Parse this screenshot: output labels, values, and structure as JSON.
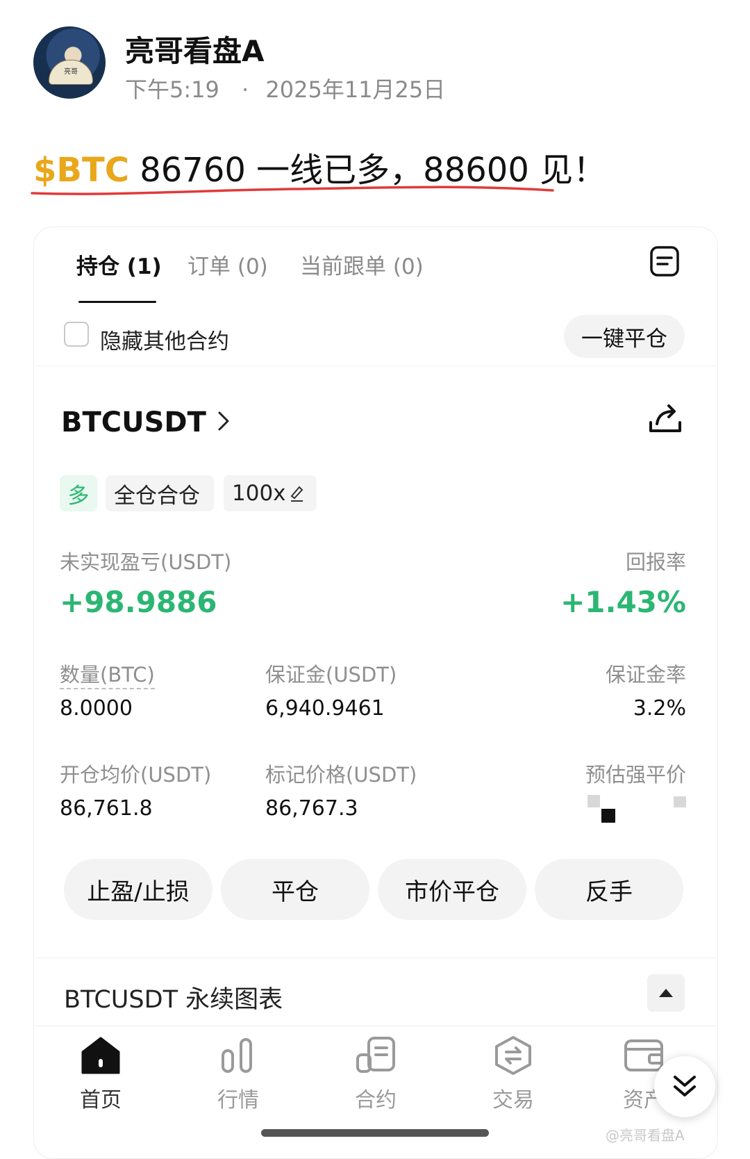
{
  "post": {
    "author": "亮哥看盘A",
    "time": "下午5:19",
    "dot": "·",
    "date": "2025年11月25日",
    "avatar_text": "亮哥",
    "text_ticker": "$BTC",
    "text_body": " 86760 一线已多，88600 见！",
    "accent_color": "#e9a71a",
    "underline_color": "#e03b3b"
  },
  "tabs": [
    {
      "label": "持仓 (1)",
      "active": true
    },
    {
      "label": "订单 (0)",
      "active": false
    },
    {
      "label": "当前跟单 (0)",
      "active": false
    }
  ],
  "filter": {
    "hide_other_label": "隐藏其他合约",
    "close_all_label": "一键平仓"
  },
  "position": {
    "symbol": "BTCUSDT",
    "tags": [
      "多",
      "全仓合仓",
      "100x"
    ],
    "pnl_label": "未实现盈亏(USDT)",
    "pnl_value": "+98.9886",
    "roe_label": "回报率",
    "roe_value": "+1.43%",
    "qty_label": "数量(BTC)",
    "qty_value": "8.0000",
    "margin_label": "保证金(USDT)",
    "margin_value": "6,940.9461",
    "margin_ratio_label": "保证金率",
    "margin_ratio_value": "3.2%",
    "entry_label": "开仓均价(USDT)",
    "entry_value": "86,761.8",
    "mark_label": "标记价格(USDT)",
    "mark_value": "86,767.3",
    "liq_label": "预估强平价",
    "green_color": "#2bb673"
  },
  "actions": [
    "止盈/止损",
    "平仓",
    "市价平仓",
    "反手"
  ],
  "chart_section": {
    "title": "BTCUSDT 永续图表"
  },
  "bottom_nav": [
    {
      "label": "首页",
      "icon": "home-icon",
      "active": true
    },
    {
      "label": "行情",
      "icon": "market-icon",
      "active": false
    },
    {
      "label": "合约",
      "icon": "contract-icon",
      "active": false
    },
    {
      "label": "交易",
      "icon": "trade-icon",
      "active": false
    },
    {
      "label": "资产",
      "icon": "wallet-icon",
      "active": false
    }
  ],
  "watermark": "@亮哥看盘A"
}
